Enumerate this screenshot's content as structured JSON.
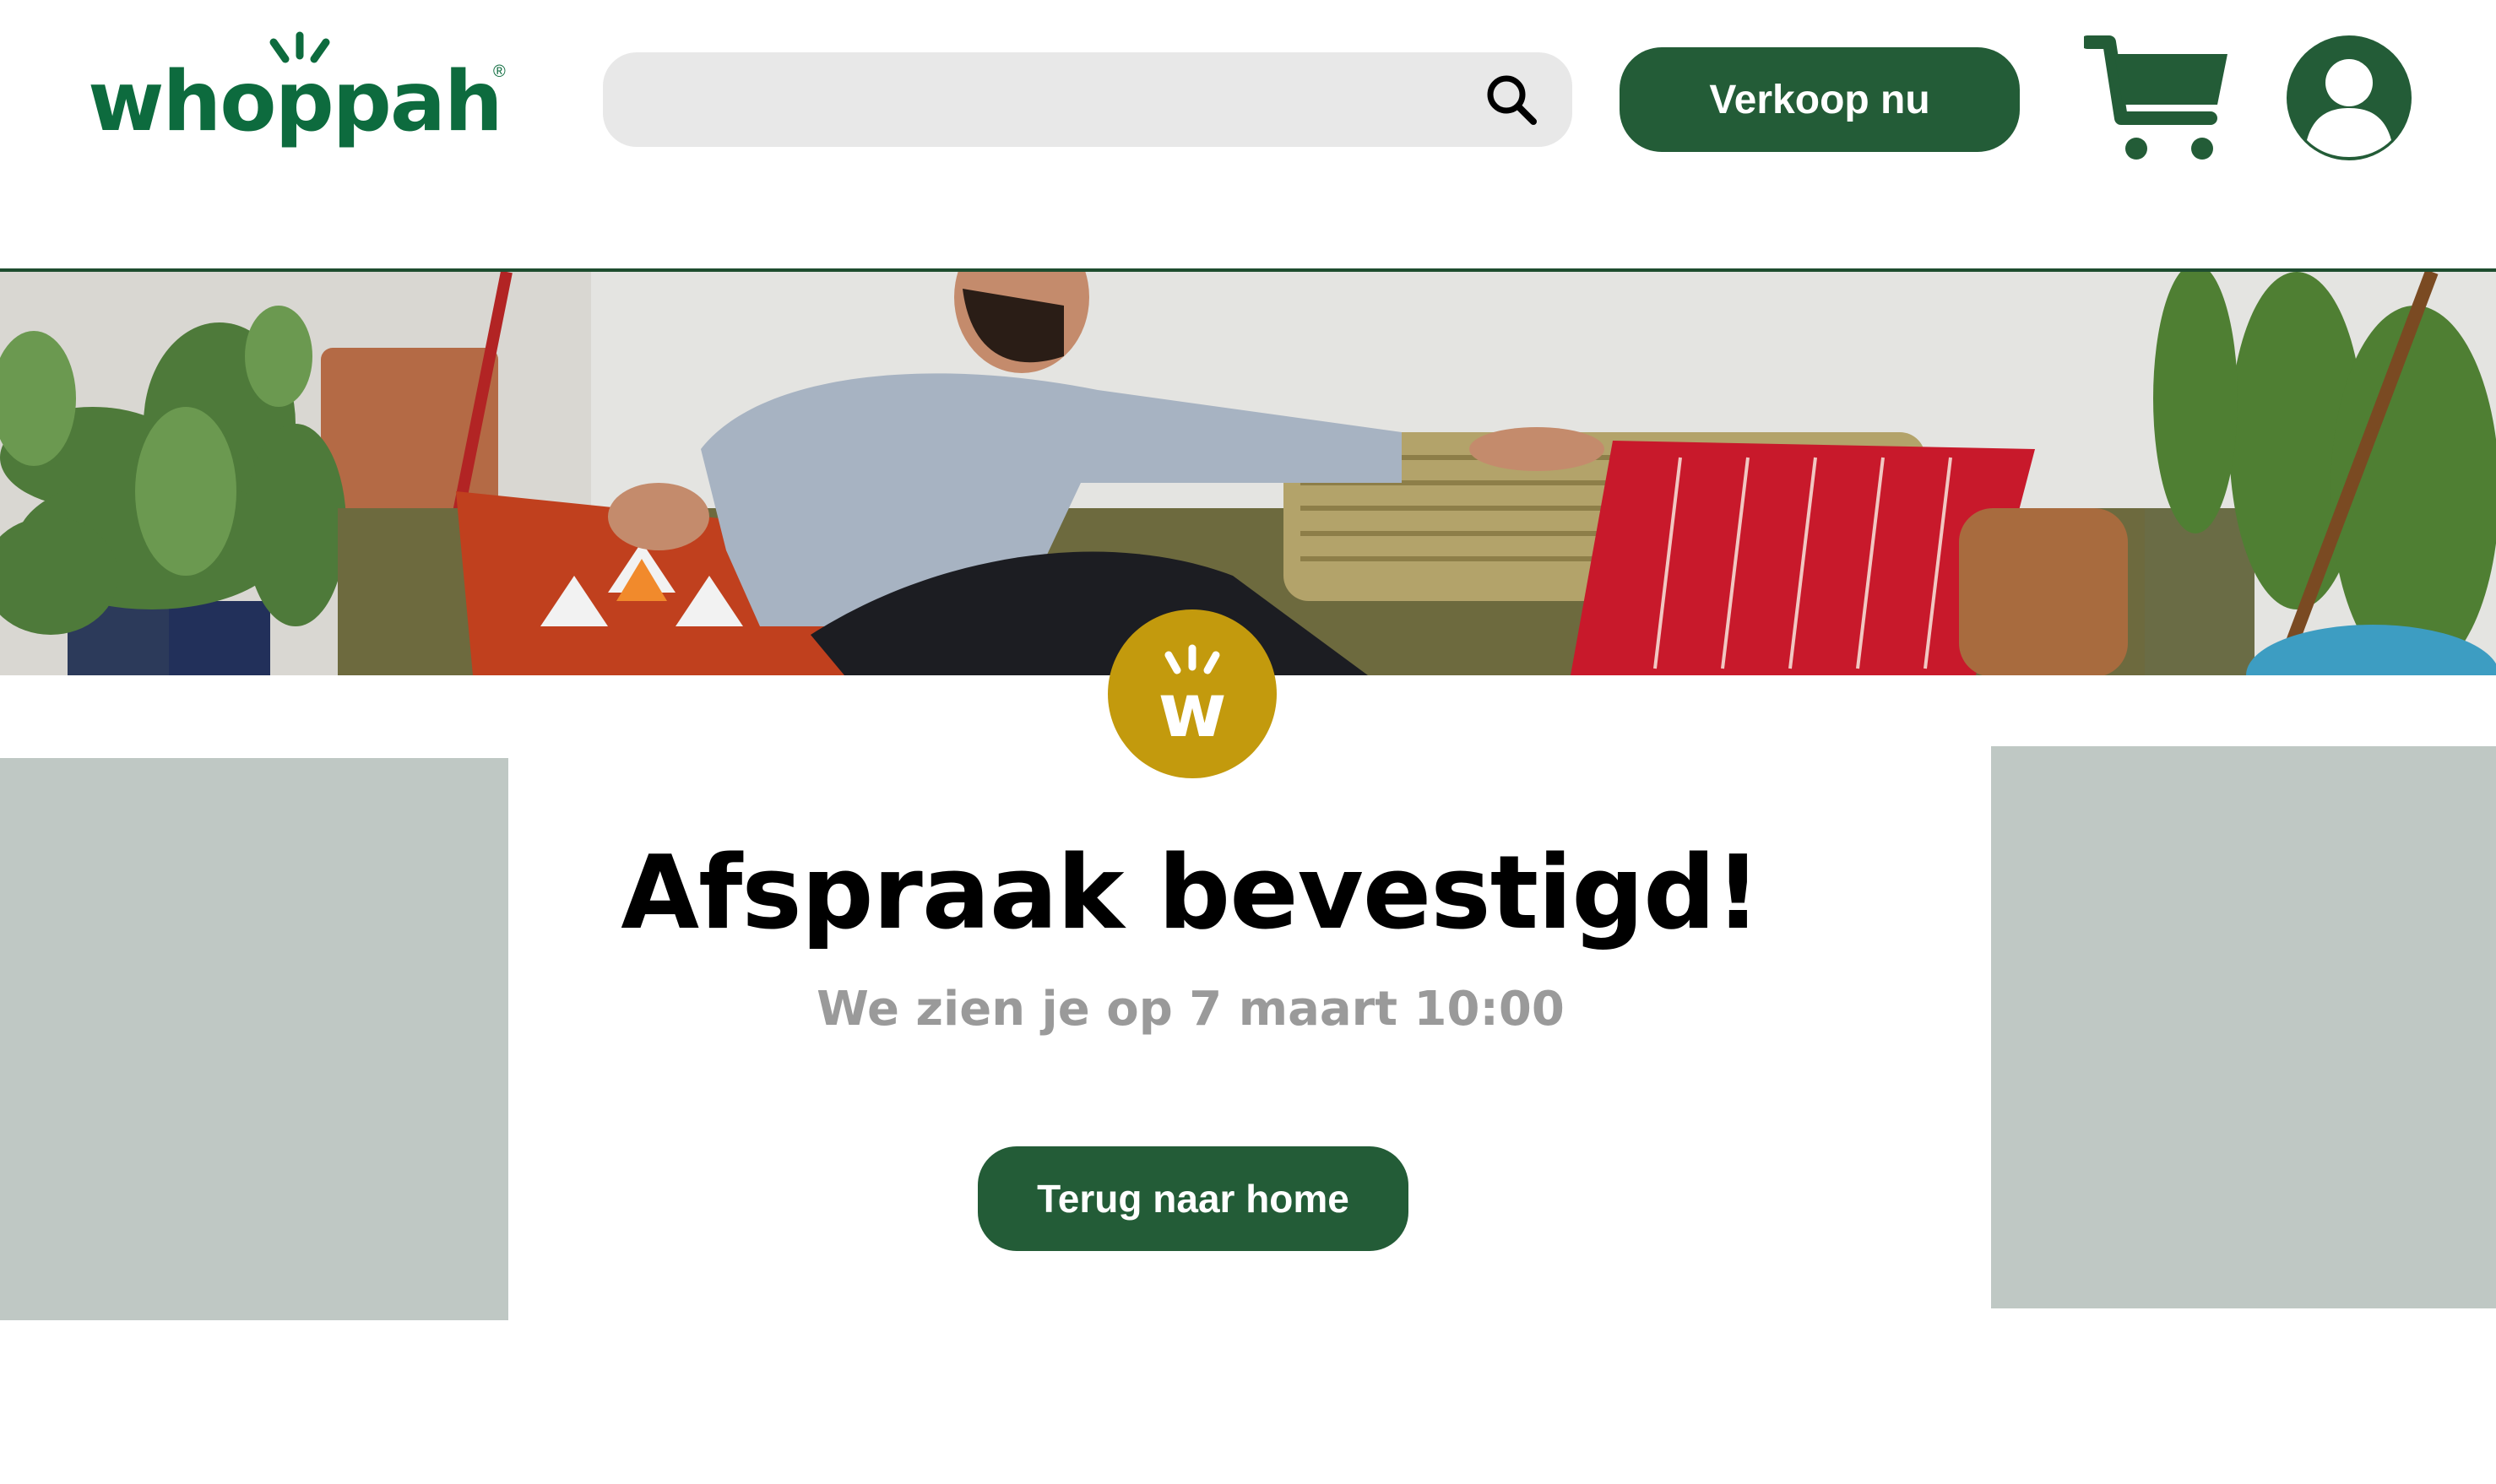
{
  "brand": {
    "name": "whoppah",
    "registered_mark": "®",
    "accent_color": "#0d6b3e",
    "button_color": "#235c37",
    "badge_color": "#c39a0d",
    "badge_letter": "w"
  },
  "header": {
    "search": {
      "value": "",
      "placeholder": "",
      "icon": "search-icon"
    },
    "sell_button_label": "Verkoop nu",
    "cart_icon": "cart-icon",
    "account_icon": "user-avatar-icon"
  },
  "hero": {
    "image": "man-on-sofa-with-cushions-photo"
  },
  "confirmation": {
    "title": "Afspraak bevestigd!",
    "subtitle": "We zien je op 7 maart 10:00",
    "home_button_label": "Terug naar home"
  }
}
